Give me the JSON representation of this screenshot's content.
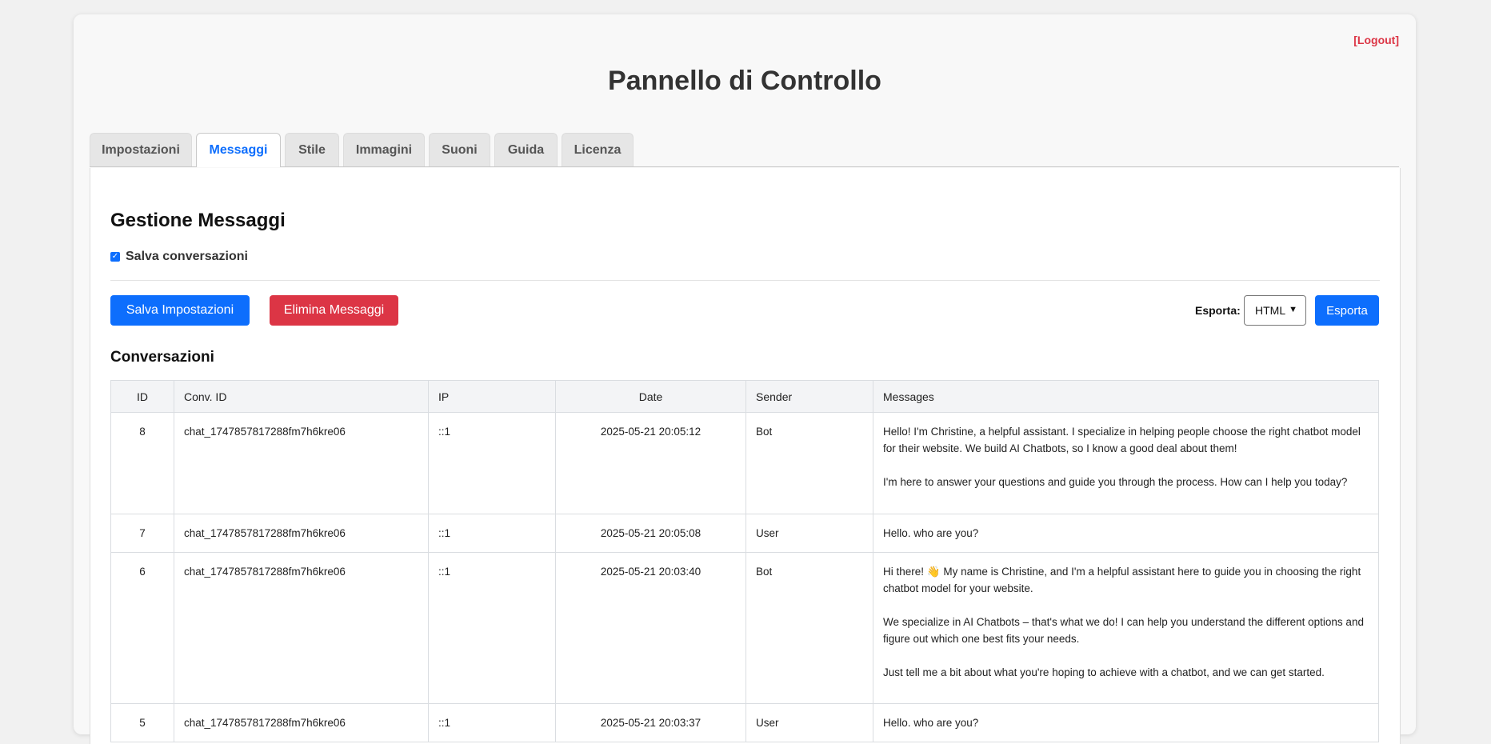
{
  "header": {
    "logout": "[Logout]",
    "title": "Pannello di Controllo"
  },
  "tabs": [
    "Impostazioni",
    "Messaggi",
    "Stile",
    "Immagini",
    "Suoni",
    "Guida",
    "Licenza"
  ],
  "active_tab": "Messaggi",
  "section": {
    "title": "Gestione Messaggi",
    "save_conversations_label": "Salva conversazioni",
    "save_conversations_checked": true,
    "save_button": "Salva Impostazioni",
    "delete_button": "Elimina Messaggi",
    "export_label": "Esporta:",
    "export_format": "HTML",
    "export_button": "Esporta",
    "conversations_title": "Conversazioni"
  },
  "table": {
    "headers": [
      "ID",
      "Conv. ID",
      "IP",
      "Date",
      "Sender",
      "Messages"
    ],
    "rows": [
      {
        "id": "8",
        "conv_id": "chat_1747857817288fm7h6kre06",
        "ip": "::1",
        "date": "2025-05-21 20:05:12",
        "sender": "Bot",
        "messages": [
          "Hello! I'm Christine, a helpful assistant. I specialize in helping people choose the right chatbot model for their website. We build AI Chatbots, so I know a good deal about them!",
          "I'm here to answer your questions and guide you through the process. How can I help you today?"
        ]
      },
      {
        "id": "7",
        "conv_id": "chat_1747857817288fm7h6kre06",
        "ip": "::1",
        "date": "2025-05-21 20:05:08",
        "sender": "User",
        "messages": [
          "Hello. who are you?"
        ]
      },
      {
        "id": "6",
        "conv_id": "chat_1747857817288fm7h6kre06",
        "ip": "::1",
        "date": "2025-05-21 20:03:40",
        "sender": "Bot",
        "messages": [
          "Hi there! 👋 My name is Christine, and I'm a helpful assistant here to guide you in choosing the right chatbot model for your website.",
          "We specialize in AI Chatbots – that's what we do! I can help you understand the different options and figure out which one best fits your needs.",
          "Just tell me a bit about what you're hoping to achieve with a chatbot, and we can get started."
        ]
      },
      {
        "id": "5",
        "conv_id": "chat_1747857817288fm7h6kre06",
        "ip": "::1",
        "date": "2025-05-21 20:03:37",
        "sender": "User",
        "messages": [
          "Hello. who are you?"
        ]
      }
    ]
  }
}
